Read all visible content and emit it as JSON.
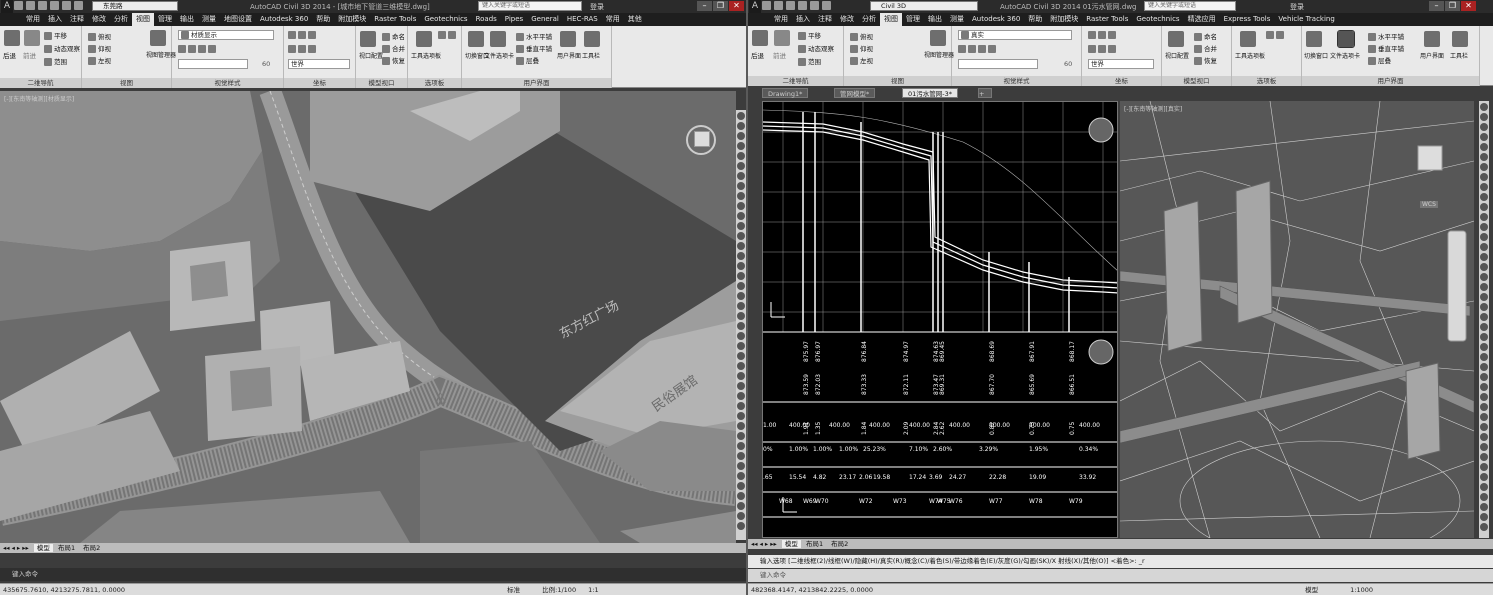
{
  "left": {
    "title": "AutoCAD Civil 3D 2014 - [城市地下管道三维模型.dwg]",
    "workspace": "东莞路",
    "search_placeholder": "键入关键字或短语",
    "login": "登录",
    "menu": [
      "常用",
      "插入",
      "注释",
      "修改",
      "分析",
      "视图",
      "管理",
      "输出",
      "测量",
      "地图设置",
      "Autodesk 360",
      "帮助",
      "附加模块",
      "Raster Tools",
      "Geotechnics",
      "Roads",
      "Pipes",
      "General",
      "HEC-RAS",
      "常用",
      "其他"
    ],
    "active_menu": "视图",
    "ribbon": {
      "nav": {
        "title": "二维导航",
        "b1": "后退",
        "b2": "前进",
        "b3": "平移",
        "b4": "动态观察",
        "b5": "范围"
      },
      "views": {
        "title": "视图",
        "b1": "俯视",
        "b2": "仰视",
        "b3": "左视",
        "b4": "视图管理器"
      },
      "visual": {
        "title": "视觉样式",
        "style": "材质显示",
        "w": "世界",
        "num": "60"
      },
      "coords": {
        "title": "坐标",
        "b1": "世界"
      },
      "model": {
        "title": "模型视口",
        "b1": "视口配置",
        "b2": "命名",
        "b3": "合并",
        "b4": "恢复"
      },
      "palettes": {
        "title": "选项板",
        "b1": "工具选项板"
      },
      "ui": {
        "title": "用户界面",
        "b1": "切换窗口",
        "b2": "文件选项卡",
        "b3": "水平平铺",
        "b4": "垂直平铺",
        "b5": "层叠",
        "b6": "用户界面",
        "b7": "工具栏"
      }
    },
    "viewport_label": "[-][东南等轴测][材质显示]",
    "label_square": "东方红广场",
    "label_museum": "民俗展馆",
    "layout_tabs": [
      "模型",
      "布局1",
      "布局2"
    ],
    "command_prompt": "键入命令",
    "coords": "435675.7610, 4213275.7811, 0.0000",
    "status_scale": "1:1",
    "status_extra": "比例:1/100",
    "status_ratio": "1:1",
    "status_user": "标准"
  },
  "right": {
    "title": "AutoCAD Civil 3D 2014   01污水管网.dwg",
    "workspace": "Civil 3D",
    "search_placeholder": "键入关键字或短语",
    "login": "登录",
    "menu": [
      "常用",
      "插入",
      "注释",
      "修改",
      "分析",
      "视图",
      "管理",
      "输出",
      "测量",
      "Autodesk 360",
      "帮助",
      "附加模块",
      "Raster Tools",
      "Geotechnics",
      "精选应用",
      "Express Tools",
      "Vehicle Tracking"
    ],
    "active_menu": "视图",
    "ribbon": {
      "nav": {
        "title": "二维导航",
        "b1": "后退",
        "b2": "前进",
        "b3": "平移",
        "b4": "动态观察",
        "b5": "范围"
      },
      "views": {
        "title": "视图",
        "b1": "俯视",
        "b2": "仰视",
        "b3": "左视",
        "b4": "视图管理器"
      },
      "visual": {
        "title": "视觉样式",
        "style": "真实",
        "w": "世界",
        "num": "60"
      },
      "coords": {
        "title": "坐标"
      },
      "model": {
        "title": "模型视口",
        "b1": "视口配置",
        "b2": "命名",
        "b3": "合并",
        "b4": "恢复"
      },
      "palettes": {
        "title": "选项板",
        "b1": "工具选项板"
      },
      "ui": {
        "title": "用户界面",
        "b1": "切换窗口",
        "b2": "文件选项卡",
        "b3": "水平平铺",
        "b4": "垂直平铺",
        "b5": "层叠",
        "b6": "用户界面",
        "b7": "工具栏"
      }
    },
    "doc_tabs": [
      "Drawing1*",
      "管网模型*",
      "01污水管网-3*"
    ],
    "viewport_label": "[-][东南等轴测][真实]",
    "wcs": "WCS",
    "profile": {
      "elev_row1": [
        "875.97",
        "876.97",
        "876.84",
        "874.97",
        "874.63",
        "869.45",
        "868.69",
        "867.91",
        "868.17"
      ],
      "elev_row2": [
        "873.59",
        "872.03",
        "873.33",
        "872.11",
        "873.47",
        "869.31",
        "867.70",
        "865.69",
        "866.51"
      ],
      "depth_row": [
        "1.91",
        "1.35",
        "1.84",
        "2.09",
        "2.84",
        "2.62",
        "0.82",
        "0.73",
        "0.75"
      ],
      "length_row": [
        "1.00",
        "400.00",
        "400.00",
        "400.00",
        "400.00",
        "400.00",
        "400.00",
        "400.00",
        "400.00"
      ],
      "slope_row": [
        "0%",
        "1.00%",
        "1.00%",
        "1.00%",
        "25.23%",
        "7.10%",
        "2.60%",
        "3.29%",
        "1.95%",
        "0.34%"
      ],
      "dist_row": [
        ".65",
        "15.54",
        "4.82",
        "23.17",
        "2.06",
        "19.58",
        "17.24",
        "3.69",
        "24.27",
        "22.28",
        "19.09",
        "33.92"
      ],
      "well_row": [
        "W68",
        "W69",
        "W70",
        "W72",
        "W73",
        "W74",
        "W75",
        "W76",
        "W77",
        "W78",
        "W79"
      ]
    },
    "layout_tabs": [
      "模型",
      "布局1",
      "布局2"
    ],
    "cmd_history": "输入选项 [二维线框(2)/线框(W)/隐藏(H)/真实(R)/概念(C)/着色(S)/带边缘着色(E)/灰度(G)/勾画(SK)/X 射线(X)/其他(O)] <着色>: _r",
    "command_prompt": "键入命令",
    "coords": "482368.4147, 4213842.2225, 0.0000",
    "status_model": "模型",
    "status_scale": "1:1000"
  }
}
